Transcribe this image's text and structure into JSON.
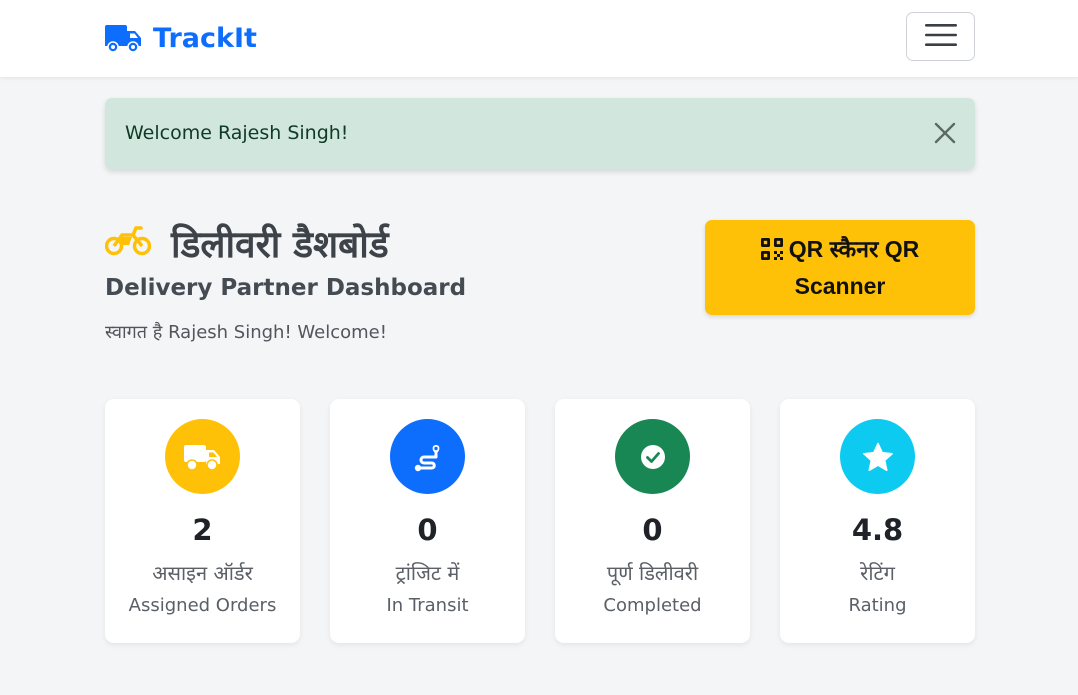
{
  "navbar": {
    "brand": "TrackIt",
    "brand_icon": "truck-icon",
    "menu_icon": "hamburger-menu-icon"
  },
  "alert": {
    "message": "Welcome Rajesh Singh!",
    "close_icon": "close-icon"
  },
  "header": {
    "icon": "motorcycle-icon",
    "title_hindi": "डिलीवरी डैशबोर्ड",
    "subtitle": "Delivery Partner Dashboard",
    "welcome": "स्वागत है Rajesh Singh! Welcome!"
  },
  "qr_button": {
    "icon": "qrcode-icon",
    "label": "QR स्कैनर QR Scanner"
  },
  "stats": [
    {
      "value": "2",
      "label_hindi": "असाइन ऑर्डर",
      "label": "Assigned Orders",
      "icon": "truck-icon",
      "color": "#ffc107"
    },
    {
      "value": "0",
      "label_hindi": "ट्रांजिट में",
      "label": "In Transit",
      "icon": "route-icon",
      "color": "#0d6efd"
    },
    {
      "value": "0",
      "label_hindi": "पूर्ण डिलीवरी",
      "label": "Completed",
      "icon": "check-circle-icon",
      "color": "#198754"
    },
    {
      "value": "4.8",
      "label_hindi": "रेटिंग",
      "label": "Rating",
      "icon": "star-icon",
      "color": "#0dcaf0"
    }
  ],
  "colors": {
    "primary": "#0d6efd",
    "warning": "#ffc107",
    "success": "#198754",
    "info": "#0dcaf0",
    "alert_bg": "#d1e7dd"
  }
}
